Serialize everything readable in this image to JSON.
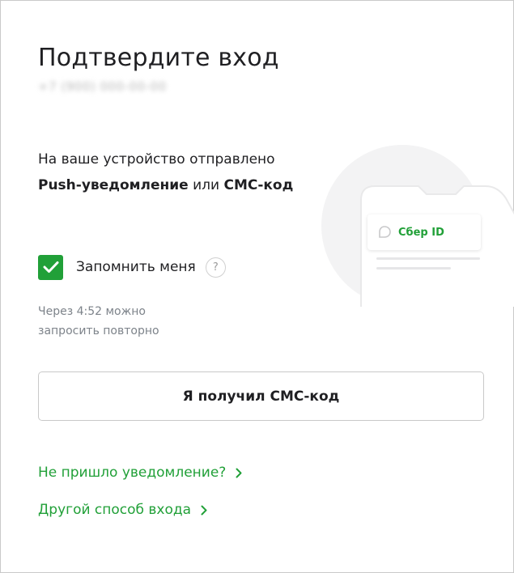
{
  "header": {
    "title": "Подтвердите вход",
    "phone_masked": "+7 (900) 000-00-00"
  },
  "message": {
    "prefix": "На ваше устройство отправлено ",
    "push": "Push-уведомление",
    "middle": " или ",
    "sms": "СМС-код"
  },
  "remember": {
    "label": "Запомнить меня",
    "checked": true,
    "help": "?"
  },
  "timer": {
    "text": "Через 4:52 можно запросить повторно"
  },
  "buttons": {
    "sms_received": "Я получил СМС-код"
  },
  "links": {
    "no_notification": "Не пришло уведомление?",
    "other_method": "Другой способ входа"
  },
  "illustration": {
    "badge": "Сбер ID"
  },
  "colors": {
    "accent": "#21a038",
    "text": "#1f1f22",
    "muted": "#7d838a",
    "border": "#c9c9c9"
  }
}
